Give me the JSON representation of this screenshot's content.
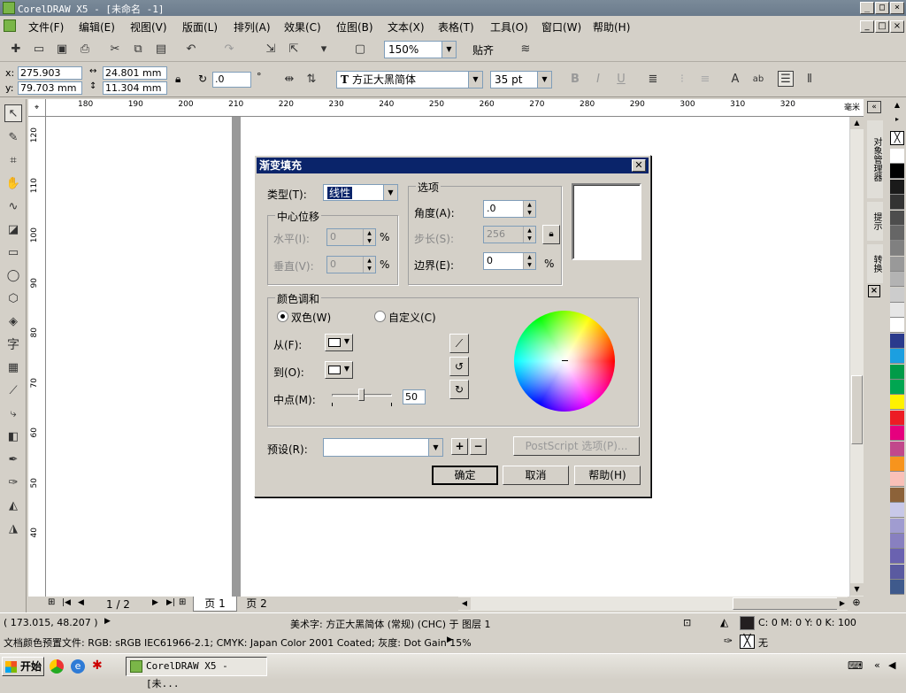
{
  "window": {
    "title": "CorelDRAW X5 - [未命名 -1]"
  },
  "menu": [
    "文件(F)",
    "编辑(E)",
    "视图(V)",
    "版面(L)",
    "排列(A)",
    "效果(C)",
    "位图(B)",
    "文本(X)",
    "表格(T)",
    "工具(O)",
    "窗口(W)",
    "帮助(H)"
  ],
  "toolbar": {
    "zoom": "150%",
    "snap_label": "贴齐"
  },
  "propbar": {
    "x": "275.903 mm",
    "y": "79.703 mm",
    "w": "24.801 mm",
    "h": "11.304 mm",
    "angle": ".0",
    "degree": "°",
    "font": "方正大黑简体",
    "size": "35 pt"
  },
  "ruler_h": [
    "180",
    "190",
    "200",
    "210",
    "220",
    "230",
    "240",
    "250",
    "260",
    "270",
    "280",
    "290",
    "300",
    "310",
    "320"
  ],
  "ruler_h_unit": "毫米",
  "ruler_v": [
    "120",
    "110",
    "100",
    "90",
    "80",
    "70",
    "60",
    "50",
    "40"
  ],
  "dialog": {
    "title": "渐变填充",
    "type_label": "类型(T):",
    "type_value": "线性",
    "center_group": "中心位移",
    "horizontal_label": "水平(I):",
    "horizontal_value": "0",
    "vertical_label": "垂直(V):",
    "vertical_value": "0",
    "pct": "%",
    "options_group": "选项",
    "angle_label": "角度(A):",
    "angle_value": ".0",
    "steps_label": "步长(S):",
    "steps_value": "256",
    "edge_label": "边界(E):",
    "edge_value": "0",
    "blend_group": "颜色调和",
    "two_color": "双色(W)",
    "custom": "自定义(C)",
    "from_label": "从(F):",
    "to_label": "到(O):",
    "mid_label": "中点(M):",
    "mid_value": "50",
    "mid_fraction": 0.5,
    "preset_label": "预设(R):",
    "postscript_btn": "PostScript 选项(P)...",
    "ok": "确定",
    "cancel": "取消",
    "help": "帮助(H)"
  },
  "pagenav": {
    "counter": "1 / 2",
    "tab1": "页 1",
    "tab2": "页 2"
  },
  "status": {
    "coords": "( 173.015, 48.207 )",
    "object": "美术字: 方正大黑简体 (常规) (CHC) 于 图层 1",
    "color_profile": "文档颜色预置文件: RGB: sRGB IEC61966-2.1; CMYK: Japan Color 2001 Coated; 灰度: Dot Gain 15%",
    "fill": "C: 0 M: 0 Y: 0 K: 100",
    "outline": "无"
  },
  "docker": {
    "tab1": "对象管理器",
    "tab2": "提示",
    "tab3": "转换"
  },
  "taskbar": {
    "start": "开始",
    "task": "CorelDRAW X5 - [未..."
  },
  "palette": [
    "#ffffff",
    "#000000",
    "#1a1a1a",
    "#333333",
    "#4d4d4d",
    "#666666",
    "#808080",
    "#999999",
    "#b3b3b3",
    "#cccccc",
    "#e6e6e6",
    "#ffffff",
    "#2a3a8c",
    "#1c9fe0",
    "#009b48",
    "#00a651",
    "#fff200",
    "#ed1c24",
    "#e6007e",
    "#c1488b",
    "#f7941d",
    "#f9c0b8",
    "#8c6239",
    "#c8c8e8",
    "#a09cd0",
    "#8880c0",
    "#6a62b0",
    "#5a5aa0",
    "#3f5a8c"
  ]
}
